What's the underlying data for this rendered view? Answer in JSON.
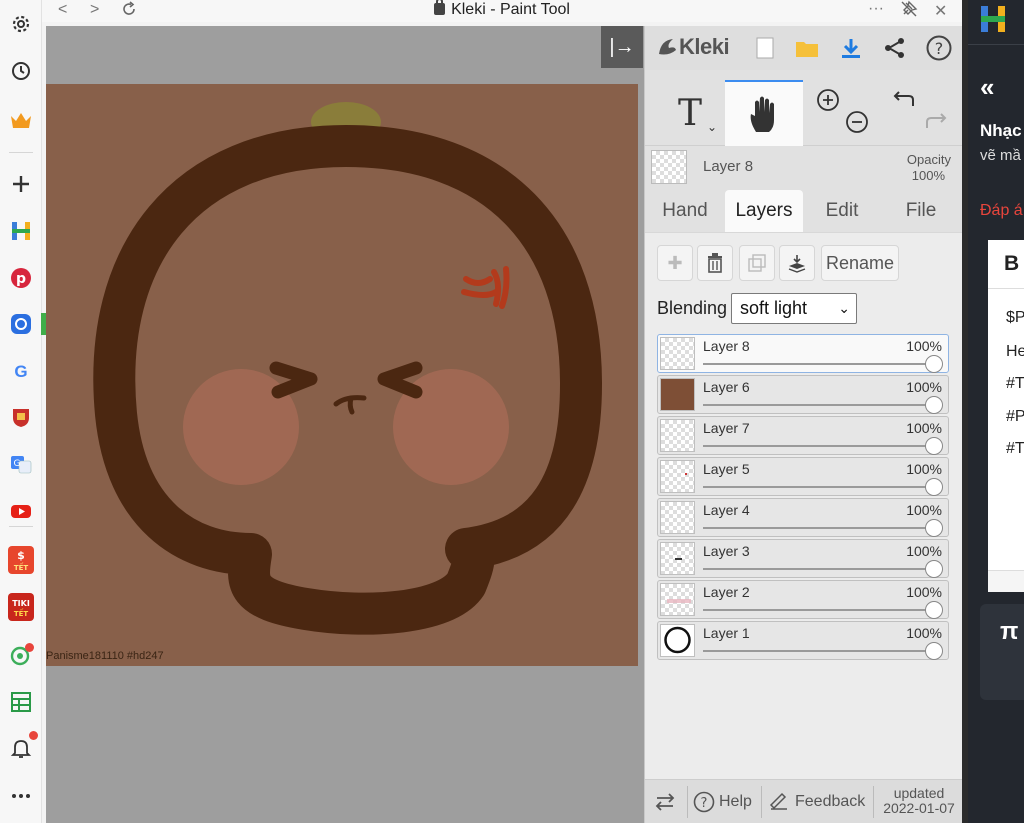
{
  "window": {
    "title": "Kleki - Paint Tool",
    "nav_back": "<",
    "nav_forward": ">",
    "more": "···",
    "close": "✕"
  },
  "sidebar": {
    "icons": [
      "gear-icon",
      "history-icon",
      "crown-icon",
      "add-icon",
      "h-app-icon",
      "pinterest-icon",
      "messenger-icon",
      "google-icon",
      "university-icon",
      "translate-icon",
      "youtube-icon",
      "shopee-tet-icon",
      "tiki-tet-icon",
      "location-icon",
      "sheets-icon",
      "bell-icon",
      "more-icon"
    ]
  },
  "canvas": {
    "watermark": "Panisme181110 #hd247",
    "collapse_label": "|→"
  },
  "kleki": {
    "logo": "Kleki",
    "tools": {
      "text_tool": "T",
      "hand_tool": "hand"
    },
    "current_layer": {
      "name": "Layer 8",
      "opacity_label": "Opacity",
      "opacity_value": "100%"
    },
    "tabs": [
      "Hand",
      "Layers",
      "Edit",
      "File"
    ],
    "active_tab": "Layers",
    "rename_label": "Rename",
    "blending": {
      "label": "Blending",
      "value": "soft light"
    },
    "layers": [
      {
        "name": "Layer 8",
        "opacity": "100%",
        "selected": true
      },
      {
        "name": "Layer 6",
        "opacity": "100%",
        "selected": false
      },
      {
        "name": "Layer 7",
        "opacity": "100%",
        "selected": false
      },
      {
        "name": "Layer 5",
        "opacity": "100%",
        "selected": false
      },
      {
        "name": "Layer 4",
        "opacity": "100%",
        "selected": false
      },
      {
        "name": "Layer 3",
        "opacity": "100%",
        "selected": false
      },
      {
        "name": "Layer 2",
        "opacity": "100%",
        "selected": false
      },
      {
        "name": "Layer 1",
        "opacity": "100%",
        "selected": false
      }
    ],
    "bottom": {
      "help": "Help",
      "feedback": "Feedback",
      "updated_label": "updated",
      "updated_date": "2022-01-07"
    }
  },
  "right_page": {
    "back_icon": "«",
    "heading": "Nhạc",
    "subtext": "vẽ mầ",
    "answer_label": "Đáp á",
    "box_title": "B",
    "lines": [
      "$P",
      "He",
      "#T",
      "#P",
      "#T"
    ],
    "pi": "π"
  },
  "colors": {
    "canvas_bg": "#88604a",
    "outline": "#4b2711",
    "accent_blue": "#3c8cf0",
    "angry_red": "#b33a1c"
  }
}
